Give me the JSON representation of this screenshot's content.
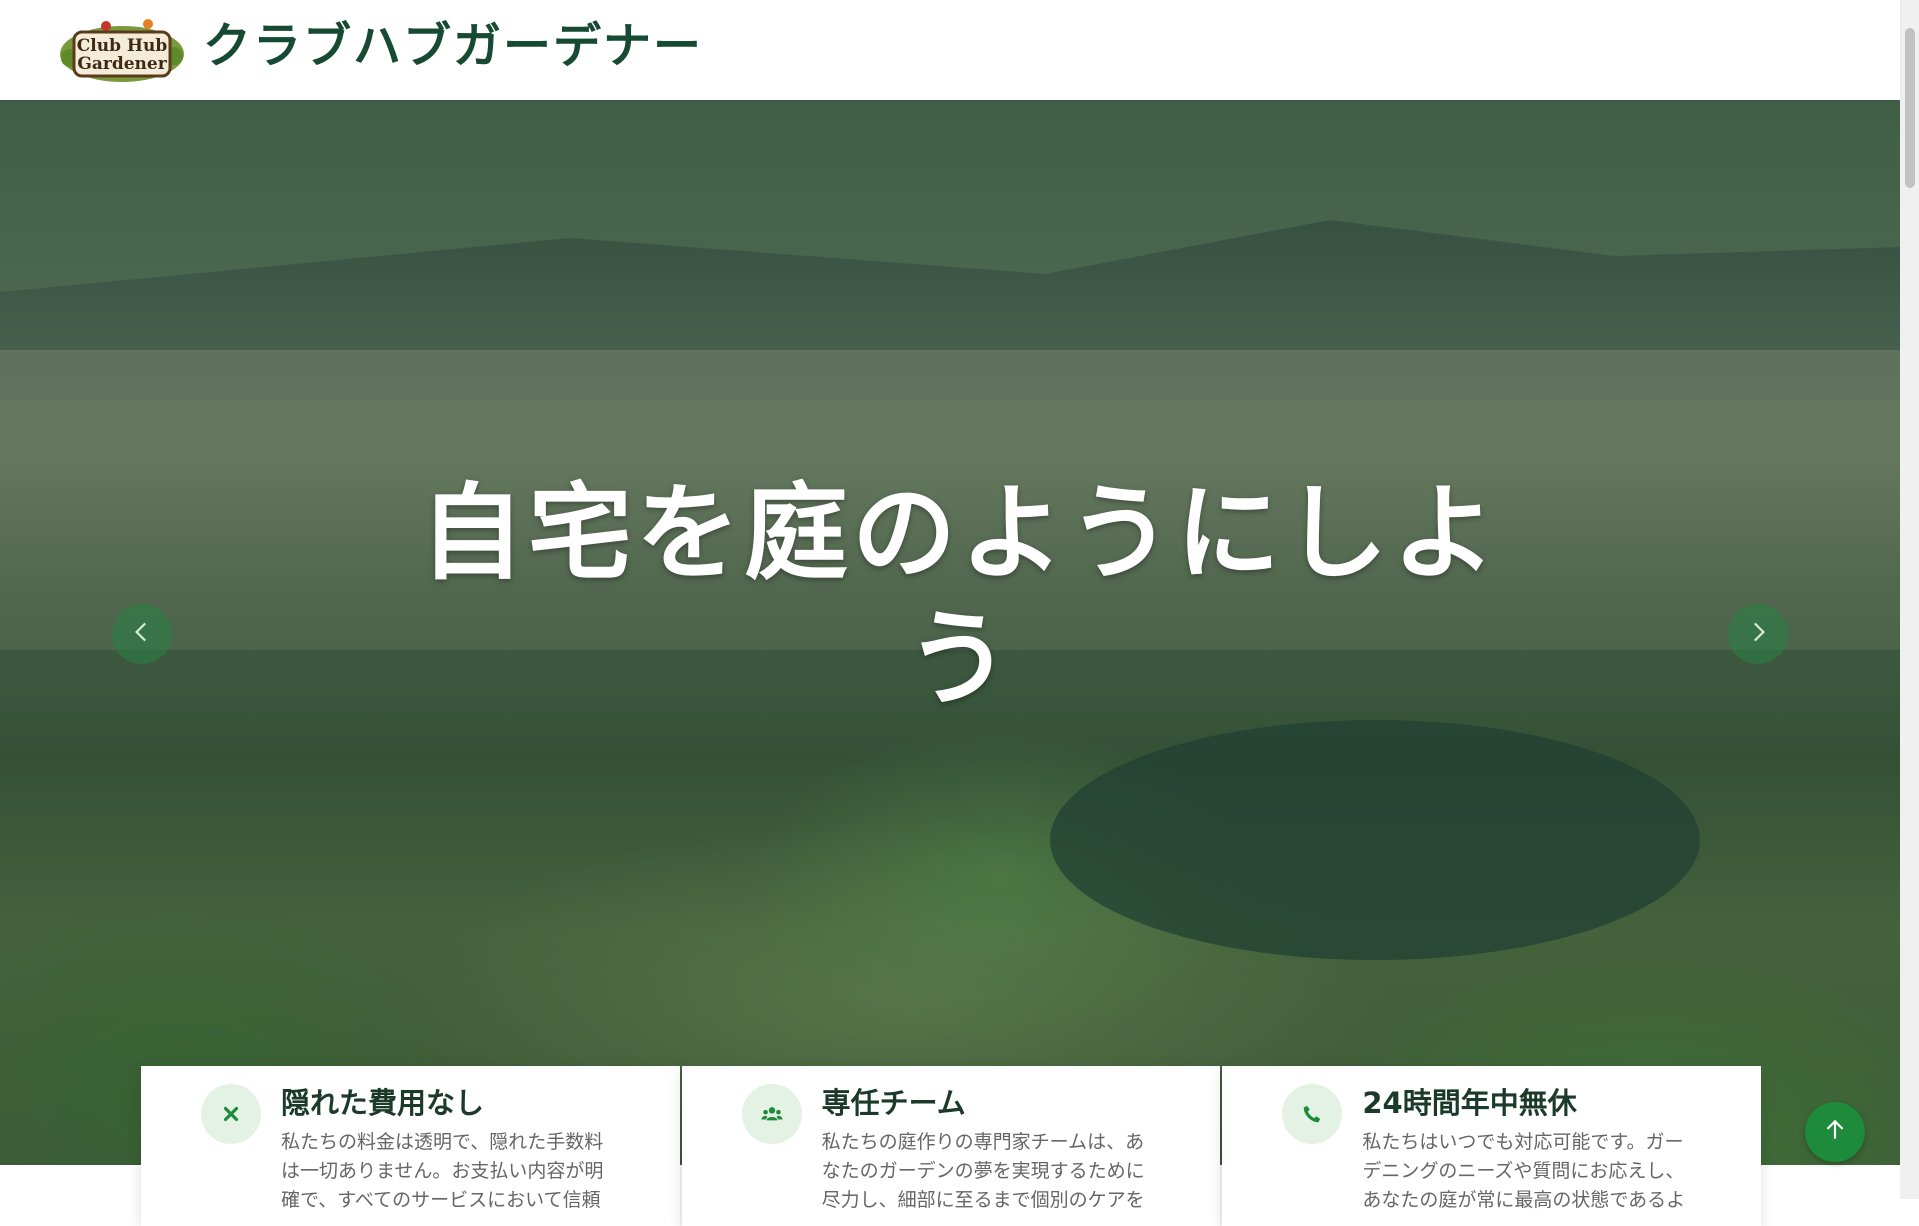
{
  "header": {
    "logo_text_line1": "Club Hub",
    "logo_text_line2": "Gardener",
    "brand_name": "クラブハブガーデナー"
  },
  "hero": {
    "title": "自宅を庭のようにしよう",
    "prev_icon": "chevron-left-icon",
    "next_icon": "chevron-right-icon"
  },
  "features": [
    {
      "icon": "close-icon",
      "title": "隠れた費用なし",
      "text": "私たちの料金は透明で、隠れた手数料は一切ありません。お支払い内容が明確で、すべてのサービスにおいて信頼"
    },
    {
      "icon": "team-icon",
      "title": "専任チーム",
      "text": "私たちの庭作りの専門家チームは、あなたのガーデンの夢を実現するために尽力し、細部に至るまで個別のケアを"
    },
    {
      "icon": "phone-icon",
      "title": "24時間年中無休",
      "text": "私たちはいつでも対応可能です。ガーデニングのニーズや質問にお応えし、あなたの庭が常に最高の状態であるよ"
    }
  ],
  "colors": {
    "brand_green": "#174a33",
    "accent_green": "#1e8a3c",
    "icon_bg": "#e3f2e4"
  },
  "totop_icon": "arrow-up-icon"
}
